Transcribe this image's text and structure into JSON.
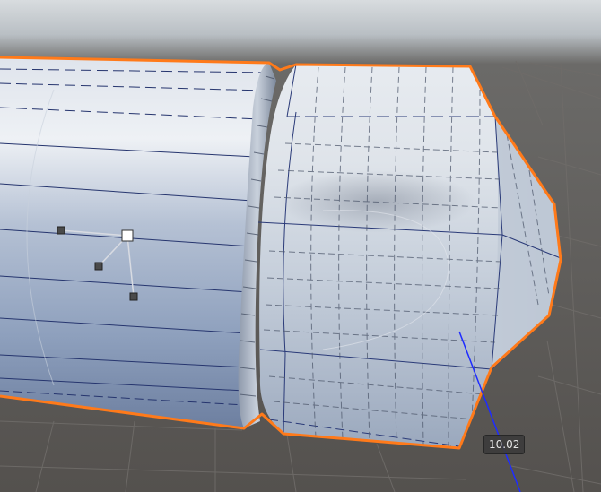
{
  "viewport": {
    "accent_selection": "#ff7a1a",
    "wireframe_color": "#1a2a6a",
    "axis_color": "#1e2cff",
    "gizmo_icons": [
      "pivot-handle-icon",
      "control-point-icon"
    ]
  },
  "measurement": {
    "value": "10.02"
  }
}
